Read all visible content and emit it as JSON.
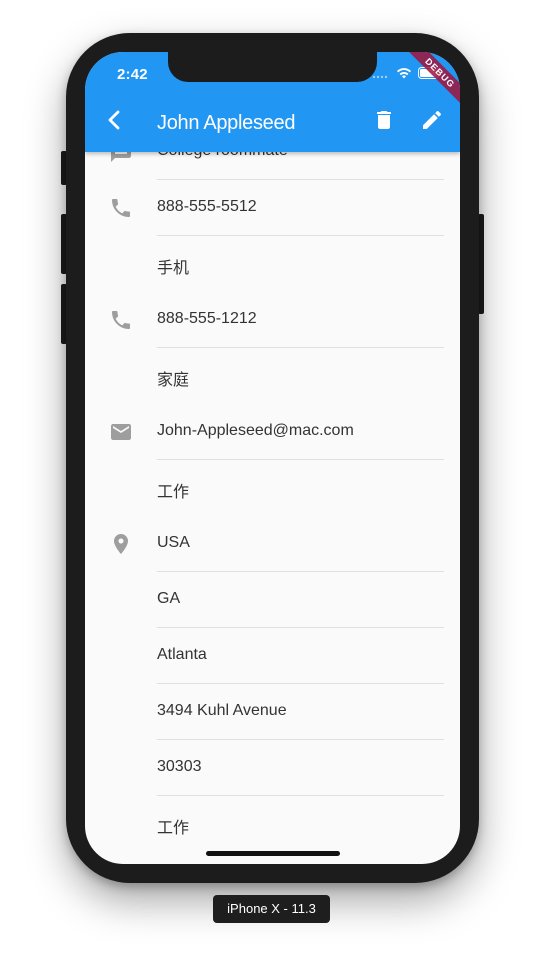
{
  "status_bar": {
    "time": "2:42"
  },
  "app_bar": {
    "title": "John Appleseed",
    "back_icon": "chevron-left-icon",
    "delete_icon": "trash-icon",
    "edit_icon": "pencil-icon",
    "color": "#2196f3"
  },
  "debug_banner": {
    "label": "DEBUG"
  },
  "rows": [
    {
      "icon": "message-icon",
      "text": "College roommate"
    },
    {
      "icon": "phone-icon",
      "text": "888-555-5512"
    },
    {
      "icon": "",
      "text": "手机"
    },
    {
      "icon": "phone-icon",
      "text": "888-555-1212"
    },
    {
      "icon": "",
      "text": "家庭"
    },
    {
      "icon": "email-icon",
      "text": "John-Appleseed@mac.com"
    },
    {
      "icon": "",
      "text": "工作"
    },
    {
      "icon": "location-pin-icon",
      "text": "USA"
    },
    {
      "icon": "",
      "text": "GA"
    },
    {
      "icon": "",
      "text": "Atlanta"
    },
    {
      "icon": "",
      "text": "3494 Kuhl Avenue"
    },
    {
      "icon": "",
      "text": "30303"
    },
    {
      "icon": "",
      "text": "工作"
    }
  ],
  "device": {
    "label": "iPhone X - 11.3"
  }
}
